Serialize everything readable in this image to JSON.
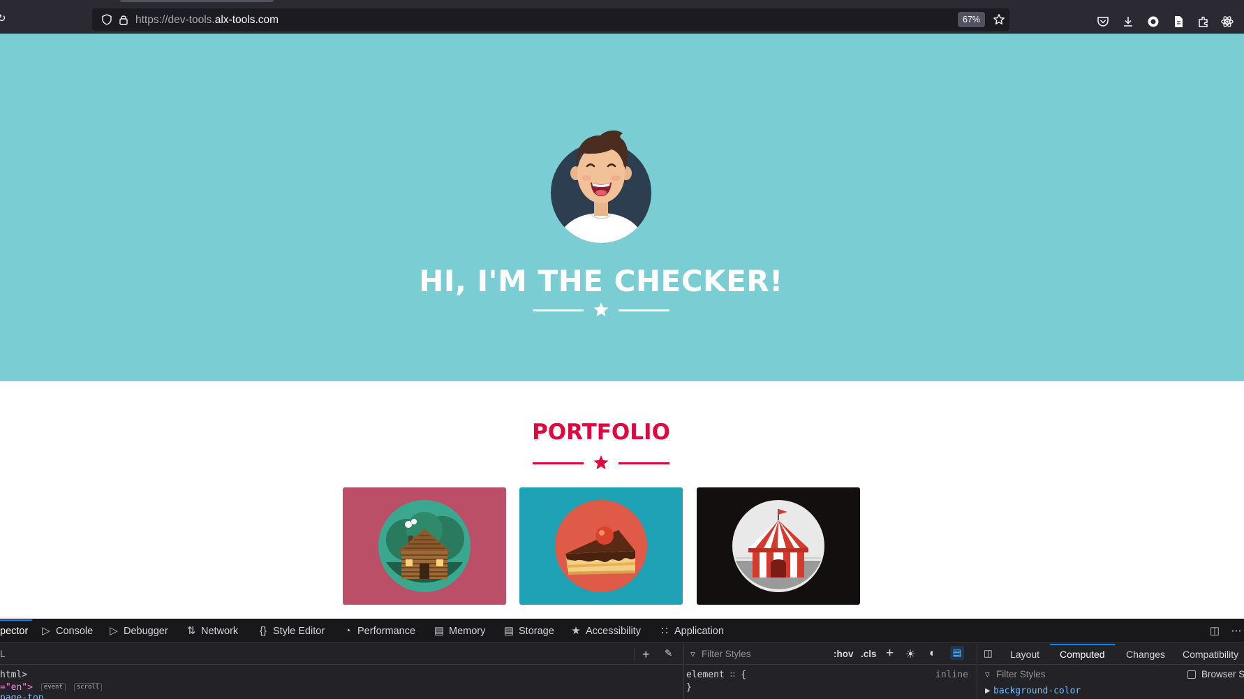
{
  "browser": {
    "url_scheme": "https://dev-tools.",
    "url_host": "alx-tools.com",
    "zoom": "67%"
  },
  "page": {
    "hero_title": "HI, I'M THE CHECKER!",
    "portfolio_title": "PORTFOLIO",
    "tiles": [
      {
        "bg": "#bc4f68",
        "icon": "cabin-icon"
      },
      {
        "bg": "#1fa2b6",
        "icon": "cake-icon"
      },
      {
        "bg": "#120f0e",
        "icon": "circus-tent-icon"
      }
    ],
    "colors": {
      "hero_bg": "#7acdd3",
      "accent": "#e0073f"
    }
  },
  "devtools": {
    "tabs": [
      {
        "label": "pector",
        "icon": ""
      },
      {
        "label": "Console",
        "icon": "console-icon"
      },
      {
        "label": "Debugger",
        "icon": "debugger-icon"
      },
      {
        "label": "Network",
        "icon": "network-icon"
      },
      {
        "label": "Style Editor",
        "icon": "style-editor-icon"
      },
      {
        "label": "Performance",
        "icon": "performance-icon"
      },
      {
        "label": "Memory",
        "icon": "memory-icon"
      },
      {
        "label": "Storage",
        "icon": "storage-icon"
      },
      {
        "label": "Accessibility",
        "icon": "accessibility-icon"
      },
      {
        "label": "Application",
        "icon": "application-icon"
      }
    ],
    "markup": {
      "line1": "html>",
      "line2_code": "=\"en\">",
      "badge_event": "event",
      "badge_scroll": "scroll",
      "line3": "page-top"
    },
    "rules": {
      "filter_placeholder": "Filter Styles",
      "hov": ":hov",
      "cls": ".cls",
      "element_rule": "element",
      "brace_open": "{",
      "inline": "inline",
      "brace_close": "}"
    },
    "sidebar": {
      "tabs": [
        "Layout",
        "Computed",
        "Changes",
        "Compatibility"
      ],
      "selected": "Computed",
      "filter_placeholder": "Filter Styles",
      "browser_styles": "Browser S",
      "property": "background-color"
    }
  }
}
